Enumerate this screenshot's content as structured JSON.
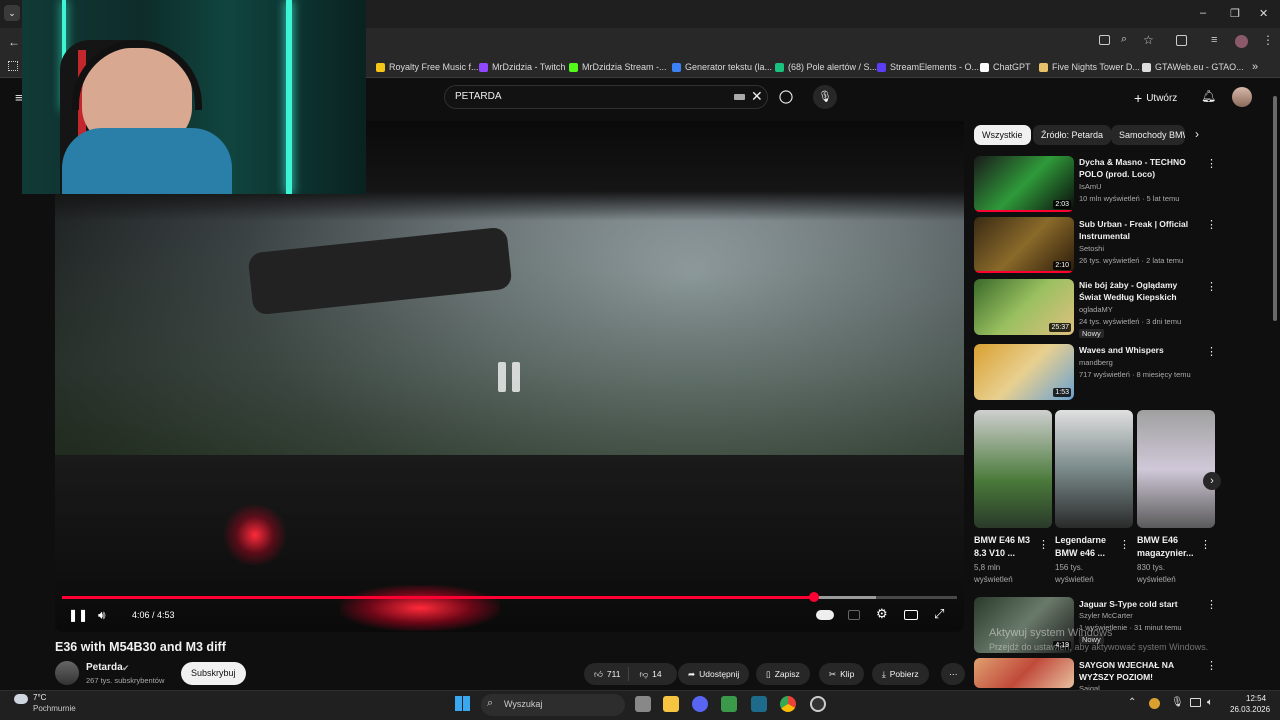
{
  "browser": {
    "bookmarks": [
      {
        "label": "Royalty Free Music f...",
        "color": "#f5c518"
      },
      {
        "label": "MrDzidzia - Twitch",
        "color": "#9146ff"
      },
      {
        "label": "MrDzidzia Stream -...",
        "color": "#53fc18"
      },
      {
        "label": "Generator tekstu (la...",
        "color": "#3b82f6"
      },
      {
        "label": "(68) Pole alertów / S...",
        "color": "#19c37d"
      },
      {
        "label": "StreamElements - O...",
        "color": "#5b3df5"
      },
      {
        "label": "ChatGPT",
        "color": "#ffffff"
      },
      {
        "label": "Five Nights Tower D...",
        "color": "#e7c26a"
      },
      {
        "label": "GTAWeb.eu - GTAO...",
        "color": "#dddddd"
      }
    ],
    "more_bookmarks": "»",
    "window_controls": [
      "–",
      "❐",
      "✕"
    ]
  },
  "youtube": {
    "search_value": "PETARDA",
    "create_label": "Utwórz"
  },
  "player": {
    "time": "4:06 / 4:53",
    "progress": 0.84,
    "buffered": 0.91
  },
  "video": {
    "title": "E36 with M54B30 and M3 diff",
    "channel": "Petarda",
    "subscribers": "267 tys. subskrybentów",
    "subscribe_label": "Subskrybuj",
    "likes": "711",
    "dislikes": "14",
    "share_label": "Udostępnij",
    "save_label": "Zapisz",
    "clip_label": "Klip",
    "download_label": "Pobierz"
  },
  "sidebar": {
    "chips": [
      "Wszystkie",
      "Źródło: Petarda",
      "Samochody BMW"
    ],
    "related": [
      {
        "title": "Dycha & Masno - TECHNO POLO (prod. Loco)",
        "channel": "IsAmU",
        "meta": "10 mln wyświetleń · 5 lat temu",
        "duration": "2:03",
        "watched": 1.0,
        "color": "#3a8a3e"
      },
      {
        "title": "Sub Urban - Freak | Official Instrumental",
        "channel": "Setoshi",
        "meta": "26 tys. wyświetleń · 2 lata temu",
        "duration": "2:10",
        "watched": 1.0,
        "color": "#6b5a2a"
      },
      {
        "title": "Nie bój żaby - Oglądamy Świat Według Kiepskich",
        "channel": "ogladaMY",
        "meta": "24 tys. wyświetleń · 3 dni temu",
        "badge": "Nowy",
        "duration": "25:37",
        "watched": 0.0,
        "color": "#5f8f3a"
      },
      {
        "title": "Waves and Whispers",
        "channel": "mandberg",
        "meta": "717 wyświetleń · 8 miesięcy temu",
        "duration": "1:53",
        "watched": 0.0,
        "color": "#c9a13a"
      },
      {
        "title": "Jaguar S-Type cold start",
        "channel": "Szyler McCarter",
        "meta": "1 wyświetlenie · 31 minut temu",
        "badge": "Nowy",
        "duration": "4:19",
        "watched": 0.0,
        "color": "#4a5a4a"
      },
      {
        "title": "SAYGON WJECHAŁ NA WYŻSZY POZIOM!",
        "channel": "Saigal",
        "meta": "",
        "duration": "",
        "watched": 0.0,
        "color": "#b05a3a"
      }
    ],
    "shorts": [
      {
        "title": "BMW E46 M3 8.3 V10 ...",
        "meta": "5,8 mln wyświetleń",
        "color": "#4a7a3a"
      },
      {
        "title": "Legendarne BMW e46 ...",
        "meta": "156 tys. wyświetleń",
        "color": "#7a8a8a"
      },
      {
        "title": "BMW E46 magazynier...",
        "meta": "830 tys. wyświetleń",
        "color": "#9aa0a6"
      }
    ]
  },
  "watermark": {
    "line1": "Aktywuj system Windows",
    "line2": "Przejdź do ustawień, aby aktywować system Windows."
  },
  "taskbar": {
    "weather_temp": "7°C",
    "weather_desc": "Pochmurnie",
    "search_label": "Wyszukaj",
    "time": "12:54",
    "date": "26.03.2026"
  }
}
